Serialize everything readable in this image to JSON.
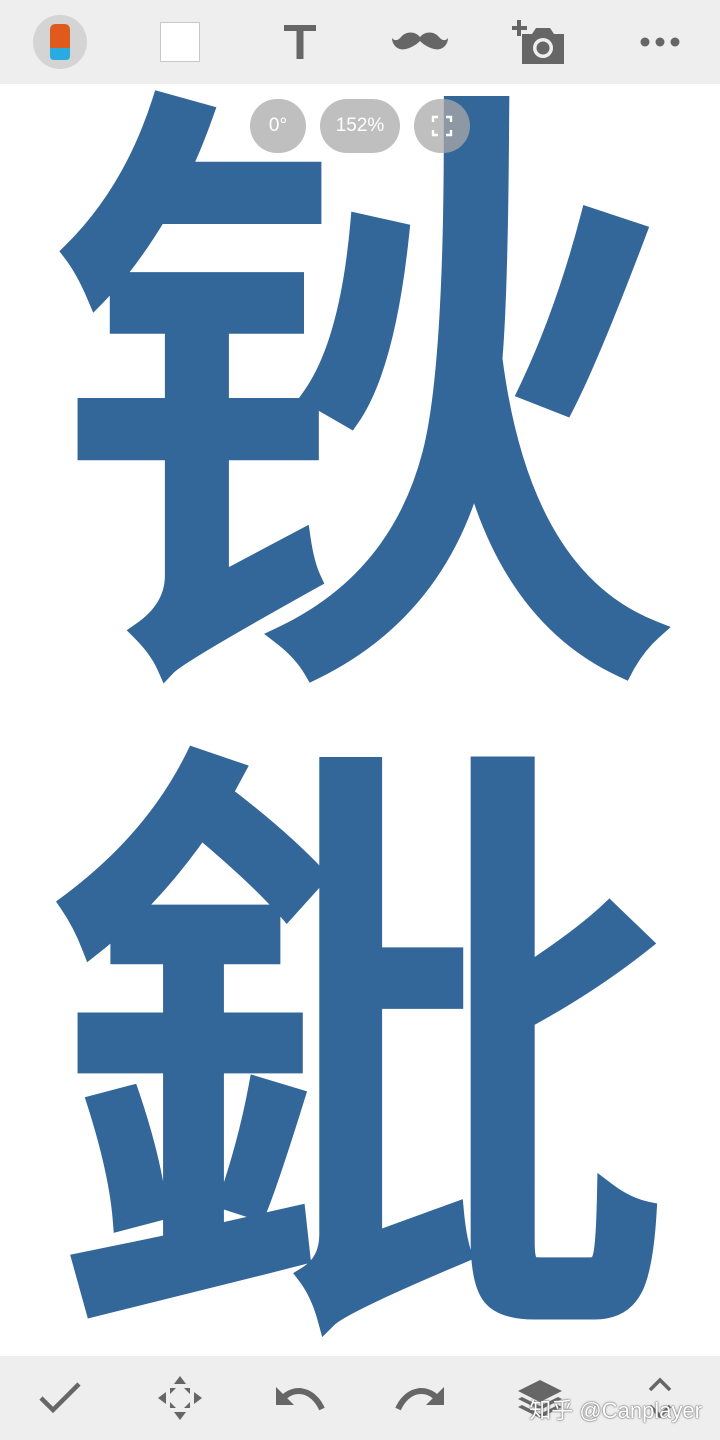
{
  "top_toolbar": {
    "tools": [
      {
        "name": "brush-tool",
        "icon": "brush-icon"
      },
      {
        "name": "color-swatch",
        "icon": "white-square-icon",
        "color": "#ffffff"
      },
      {
        "name": "text-tool",
        "icon": "text-icon",
        "glyph": "T"
      },
      {
        "name": "sticker-tool",
        "icon": "mustache-icon"
      },
      {
        "name": "add-photo-tool",
        "icon": "add-camera-icon"
      },
      {
        "name": "more-menu",
        "icon": "more-dots-icon"
      }
    ]
  },
  "canvas": {
    "rotation_label": "0°",
    "zoom_label": "152%",
    "characters": [
      "钬",
      "鈚"
    ],
    "ink_color": "#346799",
    "background_color": "#ffffff"
  },
  "bottom_toolbar": {
    "tools": [
      {
        "name": "confirm-button",
        "icon": "checkmark-icon"
      },
      {
        "name": "move-button",
        "icon": "move-arrows-icon"
      },
      {
        "name": "undo-button",
        "icon": "undo-icon"
      },
      {
        "name": "redo-button",
        "icon": "redo-icon"
      },
      {
        "name": "layers-button",
        "icon": "layers-icon"
      },
      {
        "name": "expand-button",
        "icon": "chevron-updown-icon"
      }
    ]
  },
  "watermark": "知乎 @Canplayer",
  "colors": {
    "toolbar_bg": "#eeeeee",
    "icon_gray": "#666666",
    "brush_orange": "#e05a1e",
    "brush_blue": "#29abe2"
  }
}
